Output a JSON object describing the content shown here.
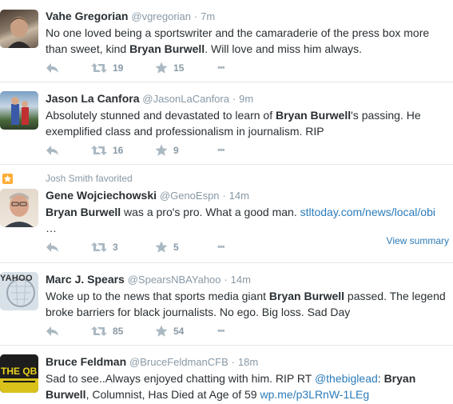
{
  "tweets": [
    {
      "fullname": "Vahe Gregorian",
      "username": "@vgregorian",
      "time": "7m",
      "text_1": "No one loved being a sportswriter and the camaraderie of the press box more than sweet, kind ",
      "text_bold": "Bryan Burwell",
      "text_2": ". Will love and miss him always.",
      "retweets": "19",
      "favorites": "15"
    },
    {
      "fullname": "Jason La Canfora",
      "username": "@JasonLaCanfora",
      "time": "9m",
      "text_1": "Absolutely stunned and devastated to learn of ",
      "text_bold": "Bryan Burwell",
      "text_2": "'s passing. He exemplified class and professionalism in journalism. RIP",
      "retweets": "16",
      "favorites": "9"
    },
    {
      "context": "Josh Smith favorited",
      "fullname": "Gene Wojciechowski",
      "username": "@GenoEspn",
      "time": "14m",
      "text_bold": "Bryan Burwell",
      "text_2": " was a pro's pro. What a good man. ",
      "link": "stltoday.com/news/local/obi",
      "ellipsis": "…",
      "retweets": "3",
      "favorites": "5",
      "view_summary": "View summary"
    },
    {
      "fullname": "Marc J. Spears",
      "username": "@SpearsNBAYahoo",
      "time": "14m",
      "avatar_text": "YAHOO",
      "text_1": "Woke up to the news that sports media giant ",
      "text_bold": "Bryan Burwell",
      "text_2": " passed. The legend broke barriers for black journalists. No ego. Big loss. Sad Day",
      "retweets": "85",
      "favorites": "54"
    },
    {
      "fullname": "Bruce Feldman",
      "username": "@BruceFeldmanCFB",
      "time": "18m",
      "avatar_text": "THE QB",
      "text_1": "Sad to see..Always enjoyed chatting with him. RIP RT ",
      "mention": "@thebiglead",
      "text_colon": ": ",
      "text_bold": "Bryan Burwell",
      "text_2": ", Columnist, Has Died at Age of 59 ",
      "link": "wp.me/p3LRnW-1LEg"
    }
  ],
  "dot": "·",
  "more": "•••",
  "colors": {
    "link": "#2b7bb9",
    "meta": "#8899a6",
    "text": "#292f33",
    "fav": "#ffac33"
  }
}
